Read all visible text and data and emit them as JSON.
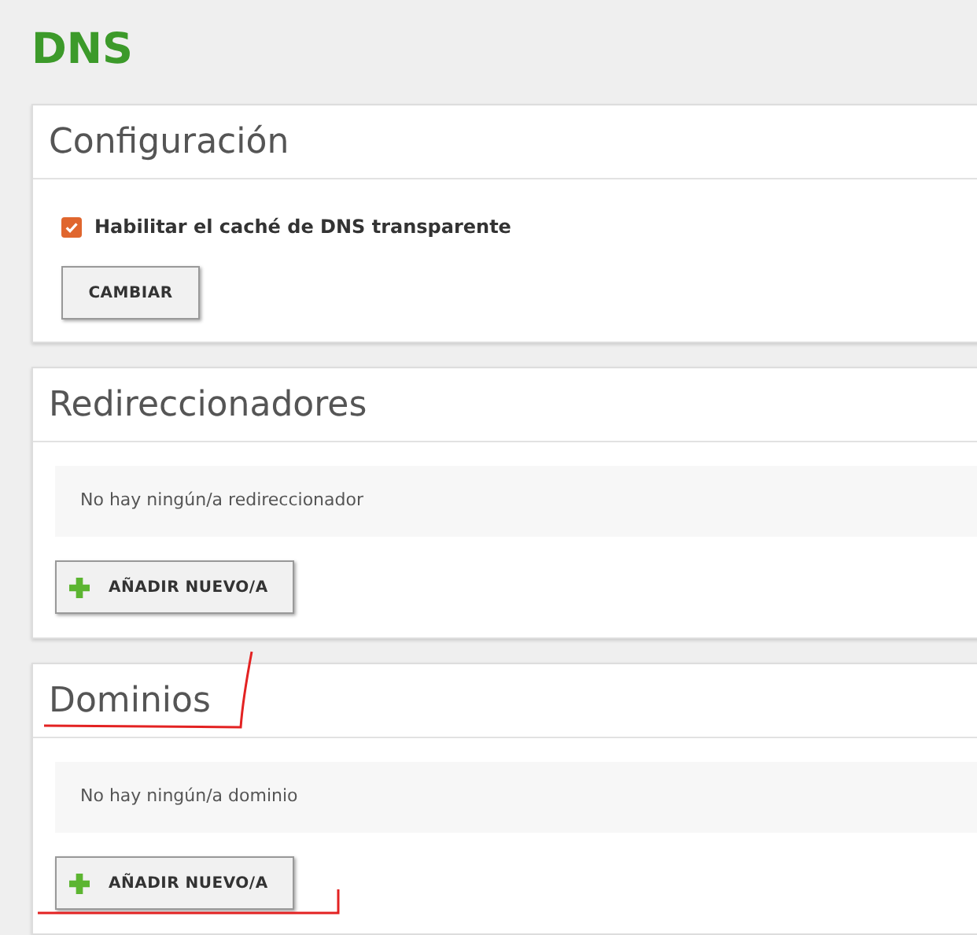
{
  "page_title": "DNS",
  "sections": [
    {
      "kind": "settings",
      "title": "Configuración",
      "checkbox": {
        "label": "Habilitar el caché de DNS transparente",
        "checked": true
      },
      "button": "CAMBIAR"
    },
    {
      "kind": "list",
      "title": "Redireccionadores",
      "empty_message": "No hay ningún/a redireccionador",
      "button": "AÑADIR NUEVO/A"
    },
    {
      "kind": "list",
      "title": "Dominios",
      "empty_message": "No hay ningún/a dominio",
      "button": "AÑADIR NUEVO/A"
    }
  ]
}
